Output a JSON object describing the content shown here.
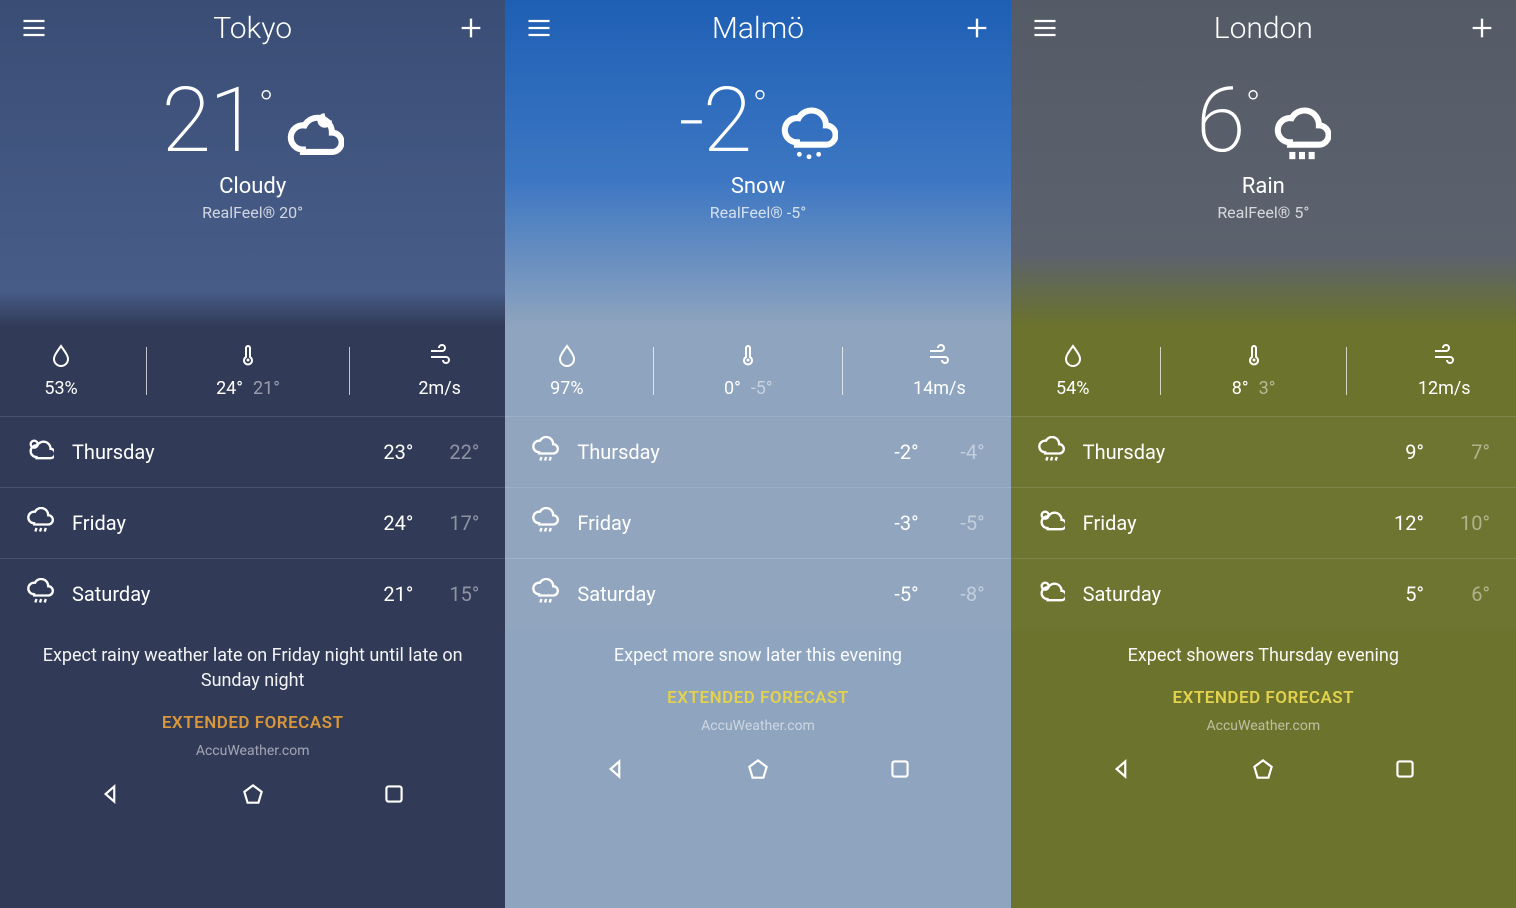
{
  "provider": "AccuWeather.com",
  "extended_label": "EXTENDED FORECAST",
  "screens": [
    {
      "id": "tokyo",
      "city": "Tokyo",
      "temp": "21",
      "cond": "Cloudy",
      "cond_icon": "cloud-moon",
      "realfeel": "RealFeel® 20°",
      "humidity": "53%",
      "hi": "24°",
      "lo": "21°",
      "wind": "2m/s",
      "forecast": [
        {
          "icon": "partly",
          "day": "Thursday",
          "hi": "23°",
          "lo": "22°"
        },
        {
          "icon": "showers",
          "day": "Friday",
          "hi": "24°",
          "lo": "17°"
        },
        {
          "icon": "showers",
          "day": "Saturday",
          "hi": "21°",
          "lo": "15°"
        }
      ],
      "summary": "Expect rainy weather late on Friday night until late on Sunday night",
      "extended_color": "#d8973c"
    },
    {
      "id": "malmo",
      "city": "Malmö",
      "temp": "-2",
      "cond": "Snow",
      "cond_icon": "cloud-snow",
      "realfeel": "RealFeel® -5°",
      "humidity": "97%",
      "hi": "0°",
      "lo": "-5°",
      "wind": "14m/s",
      "forecast": [
        {
          "icon": "showers",
          "day": "Thursday",
          "hi": "-2°",
          "lo": "-4°"
        },
        {
          "icon": "showers",
          "day": "Friday",
          "hi": "-3°",
          "lo": "-5°"
        },
        {
          "icon": "showers",
          "day": "Saturday",
          "hi": "-5°",
          "lo": "-8°"
        }
      ],
      "summary": "Expect more snow later this evening",
      "extended_color": "#e3d24e"
    },
    {
      "id": "london",
      "city": "London",
      "temp": "6",
      "cond": "Rain",
      "cond_icon": "cloud-rain",
      "realfeel": "RealFeel® 5°",
      "humidity": "54%",
      "hi": "8°",
      "lo": "3°",
      "wind": "12m/s",
      "forecast": [
        {
          "icon": "showers",
          "day": "Thursday",
          "hi": "9°",
          "lo": "7°"
        },
        {
          "icon": "partly",
          "day": "Friday",
          "hi": "12°",
          "lo": "10°"
        },
        {
          "icon": "partly",
          "day": "Saturday",
          "hi": "5°",
          "lo": "6°"
        }
      ],
      "summary": "Expect showers Thursday evening",
      "extended_color": "#e3d24e"
    }
  ]
}
